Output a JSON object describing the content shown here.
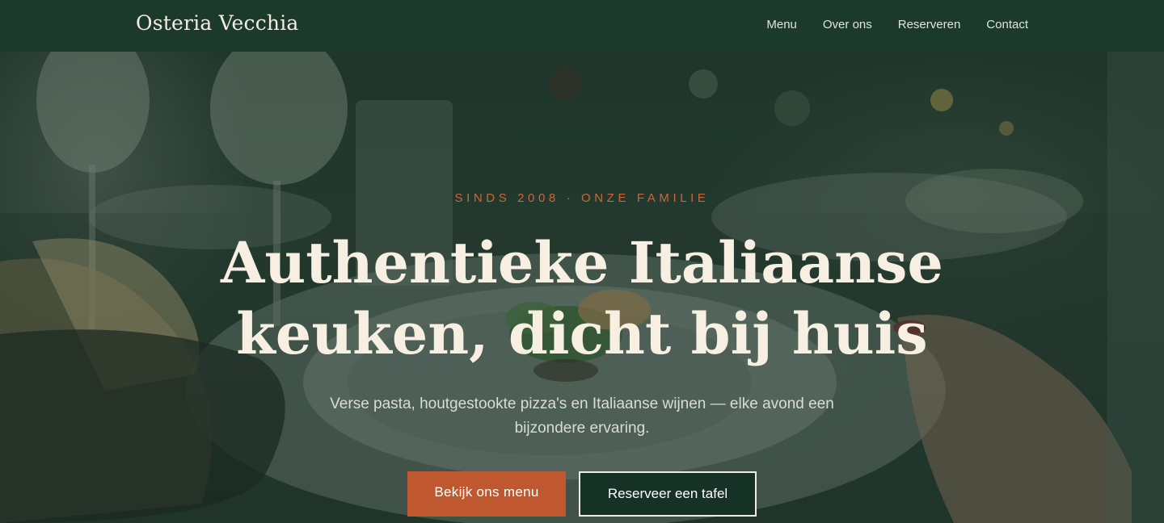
{
  "header": {
    "brand": "Osteria Vecchia",
    "nav": [
      {
        "label": "Menu"
      },
      {
        "label": "Over ons"
      },
      {
        "label": "Reserveren"
      },
      {
        "label": "Contact"
      }
    ]
  },
  "hero": {
    "eyebrow": "SINDS 2008 · ONZE FAMILIE",
    "headline_line1": "Authentieke Italiaanse",
    "headline_line2": "keuken, dicht bij huis",
    "subtitle": "Verse pasta, houtgestookte pizza's en Italiaanse wijnen — elke avond een bijzondere ervaring.",
    "primary_cta": "Bekijk ons menu",
    "secondary_cta": "Reserveer een tafel"
  },
  "colors": {
    "header_bg": "#1c3a2b",
    "accent": "#c0582f",
    "headline": "#f6efe2",
    "overlay": "#163025"
  }
}
